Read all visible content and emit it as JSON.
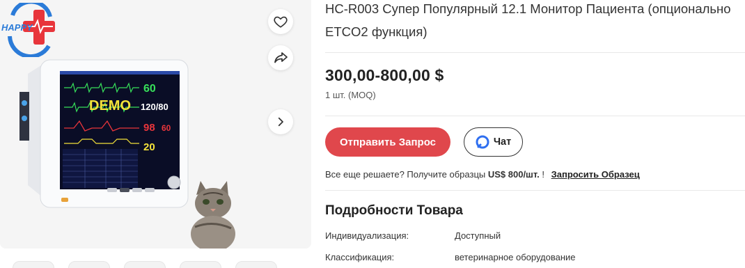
{
  "gallery": {
    "logo_text": "HAPPY",
    "monitor_screen_text": "DEMO",
    "monitor_values": [
      "60",
      "120/80",
      "98",
      "60",
      "20"
    ],
    "thumbnail_count": 5
  },
  "product": {
    "title": "HC-R003 Супер Популярный 12.1 Монитор Пациента (опционально ETCO2 функция)",
    "price": "300,00-800,00 $",
    "moq": "1 шт. (MOQ)"
  },
  "actions": {
    "inquiry_label": "Отправить Запрос",
    "chat_label": "Чат"
  },
  "sample": {
    "prefix": "Все еще решаете? Получите образцы",
    "price": "US$ 800/шт.",
    "suffix": "!",
    "link_label": "Запросить Образец"
  },
  "details": {
    "title": "Подробности Товара",
    "specs": [
      {
        "label": "Индивидуализация:",
        "value": "Доступный"
      },
      {
        "label": "Классификация:",
        "value": "ветеринарное оборудование"
      }
    ]
  },
  "colors": {
    "accent": "#e0474c",
    "chat_icon": "#2f6ff0"
  },
  "icons": [
    "heart-icon",
    "share-icon",
    "chevron-right-icon",
    "chat-bubble-icon"
  ]
}
